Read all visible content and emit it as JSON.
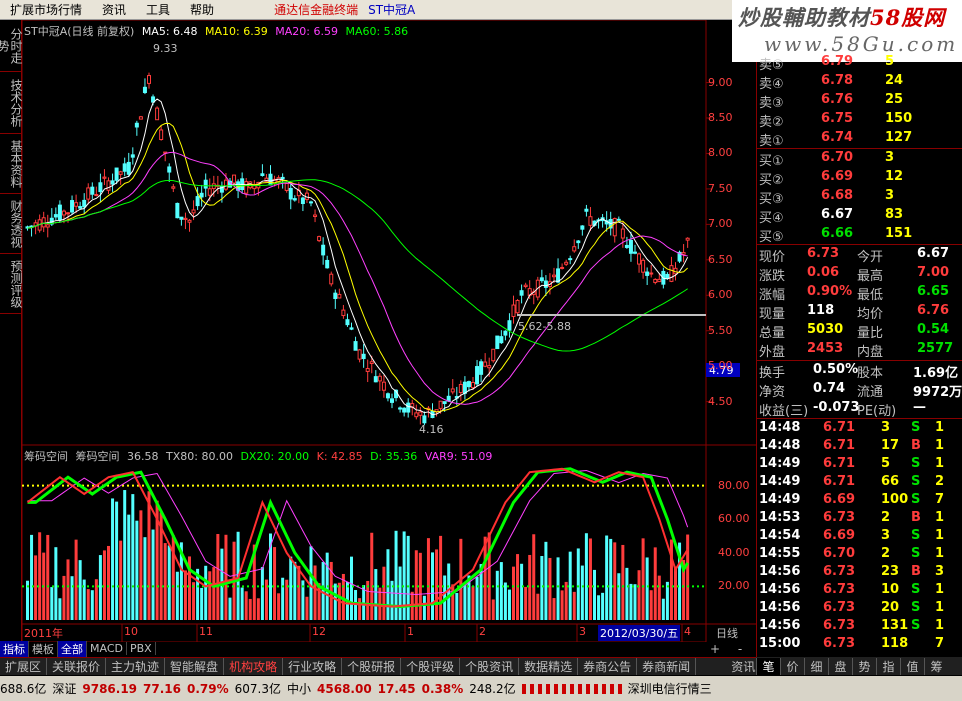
{
  "menu": {
    "items": [
      "扩展市场行情",
      "资讯",
      "工具",
      "帮助"
    ],
    "title": "通达信金融终端",
    "stock": "ST中冠A"
  },
  "watermark": {
    "line1a": "炒股輔助教材",
    "line1b": "58股网",
    "line2": "www.58Gu.com"
  },
  "side_tabs": [
    "分时走势",
    "技术分析",
    "基本资料",
    "财务透视",
    "预测评级"
  ],
  "main_chart": {
    "name": "ST中冠A(日线 前复权)",
    "ma5": "MA5: 6.48",
    "ma10": "MA10: 6.39",
    "ma20": "MA20: 6.59",
    "ma60": "MA60: 5.86",
    "high_label": "9.33",
    "low_label": "4.16",
    "range_label": "5.62-5.88",
    "price_tag": "4.79",
    "yticks": [
      "9.00",
      "8.50",
      "8.00",
      "7.50",
      "7.00",
      "6.50",
      "6.00",
      "5.50",
      "5.00",
      "4.50"
    ]
  },
  "chart_data": {
    "type": "candlestick",
    "series_ma": [
      "MA5",
      "MA10",
      "MA20",
      "MA60"
    ],
    "ylim": [
      4.1,
      9.6
    ],
    "high": 9.33,
    "low": 4.16
  },
  "indicator": {
    "name1": "筹码空间",
    "name2": "筹码空间",
    "v1": "36.58",
    "tx80": "TX80: 80.00",
    "dx20": "DX20: 20.00",
    "k": "K: 42.85",
    "d": "D: 35.36",
    "var9": "VAR9: 51.09",
    "yticks": [
      "80.00",
      "60.00",
      "40.00",
      "20.00"
    ]
  },
  "xaxis": {
    "labels": [
      "2011年",
      "10",
      "11",
      "12",
      "1",
      "2",
      "3",
      "4"
    ],
    "date_box": "2012/03/30/五",
    "period": "日线"
  },
  "order_book": {
    "sell": [
      {
        "label": "卖⑤",
        "price": "6.79",
        "vol": "5"
      },
      {
        "label": "卖④",
        "price": "6.78",
        "vol": "24"
      },
      {
        "label": "卖③",
        "price": "6.76",
        "vol": "25"
      },
      {
        "label": "卖②",
        "price": "6.75",
        "vol": "150"
      },
      {
        "label": "卖①",
        "price": "6.74",
        "vol": "127"
      }
    ],
    "buy": [
      {
        "label": "买①",
        "price": "6.70",
        "vol": "3"
      },
      {
        "label": "买②",
        "price": "6.69",
        "vol": "12"
      },
      {
        "label": "买③",
        "price": "6.68",
        "vol": "3"
      },
      {
        "label": "买④",
        "price": "6.67",
        "vol": "83"
      },
      {
        "label": "买⑤",
        "price": "6.66",
        "vol": "151"
      }
    ]
  },
  "quote": [
    {
      "l1": "现价",
      "v1": "6.73",
      "c1": "red",
      "l2": "今开",
      "v2": "6.67",
      "c2": "wht"
    },
    {
      "l1": "涨跌",
      "v1": "0.06",
      "c1": "red",
      "l2": "最高",
      "v2": "7.00",
      "c2": "red"
    },
    {
      "l1": "涨幅",
      "v1": "0.90%",
      "c1": "red",
      "l2": "最低",
      "v2": "6.65",
      "c2": "grn"
    },
    {
      "l1": "现量",
      "v1": "118",
      "c1": "wht",
      "l2": "均价",
      "v2": "6.76",
      "c2": "red"
    },
    {
      "l1": "总量",
      "v1": "5030",
      "c1": "yel",
      "l2": "量比",
      "v2": "0.54",
      "c2": "grn"
    },
    {
      "l1": "外盘",
      "v1": "2453",
      "c1": "red",
      "l2": "内盘",
      "v2": "2577",
      "c2": "grn"
    }
  ],
  "fund": [
    {
      "l1": "换手",
      "v1": "0.50%",
      "l2": "股本",
      "v2": "1.69亿"
    },
    {
      "l1": "净资",
      "v1": "0.74",
      "l2": "流通",
      "v2": "9972万"
    },
    {
      "l1": "收益(三)",
      "v1": "-0.073",
      "l2": "PE(动)",
      "v2": "—"
    }
  ],
  "ticks": [
    {
      "t": "14:48",
      "p": "6.71",
      "v": "3",
      "s": "S",
      "n": "1"
    },
    {
      "t": "14:48",
      "p": "6.71",
      "v": "17",
      "s": "B",
      "n": "1"
    },
    {
      "t": "14:49",
      "p": "6.71",
      "v": "5",
      "s": "S",
      "n": "1"
    },
    {
      "t": "14:49",
      "p": "6.71",
      "v": "66",
      "s": "S",
      "n": "2"
    },
    {
      "t": "14:49",
      "p": "6.69",
      "v": "100",
      "s": "S",
      "n": "7"
    },
    {
      "t": "14:53",
      "p": "6.73",
      "v": "2",
      "s": "B",
      "n": "1"
    },
    {
      "t": "14:54",
      "p": "6.69",
      "v": "3",
      "s": "S",
      "n": "1"
    },
    {
      "t": "14:55",
      "p": "6.70",
      "v": "2",
      "s": "S",
      "n": "1"
    },
    {
      "t": "14:56",
      "p": "6.73",
      "v": "23",
      "s": "B",
      "n": "3"
    },
    {
      "t": "14:56",
      "p": "6.73",
      "v": "10",
      "s": "S",
      "n": "1"
    },
    {
      "t": "14:56",
      "p": "6.73",
      "v": "20",
      "s": "S",
      "n": "1"
    },
    {
      "t": "14:56",
      "p": "6.73",
      "v": "131",
      "s": "S",
      "n": "1"
    },
    {
      "t": "15:00",
      "p": "6.73",
      "v": "118",
      "s": "",
      "n": "7"
    }
  ],
  "bottom_tabs": [
    "指标",
    "模板",
    "全部",
    "MACD",
    "PBX"
  ],
  "nav_tabs": [
    "扩展区",
    "关联报价",
    "主力轨迹",
    "智能解盘",
    "机构攻略",
    "行业攻略",
    "个股研报",
    "个股评级",
    "个股资讯",
    "数据精选",
    "券商公告",
    "券商新闻",
    "资讯工场"
  ],
  "right_tabs": [
    "笔",
    "价",
    "细",
    "盘",
    "势",
    "指",
    "值",
    "筹"
  ],
  "status": {
    "a": "688.6亿",
    "b": "深证",
    "c": "9786.19",
    "d": "77.16",
    "e": "0.79%",
    "f": "607.3亿",
    "g": "中小",
    "h": "4568.00",
    "i": "17.45",
    "j": "0.38%",
    "k": "248.2亿",
    "l": "深圳电信行情三"
  }
}
